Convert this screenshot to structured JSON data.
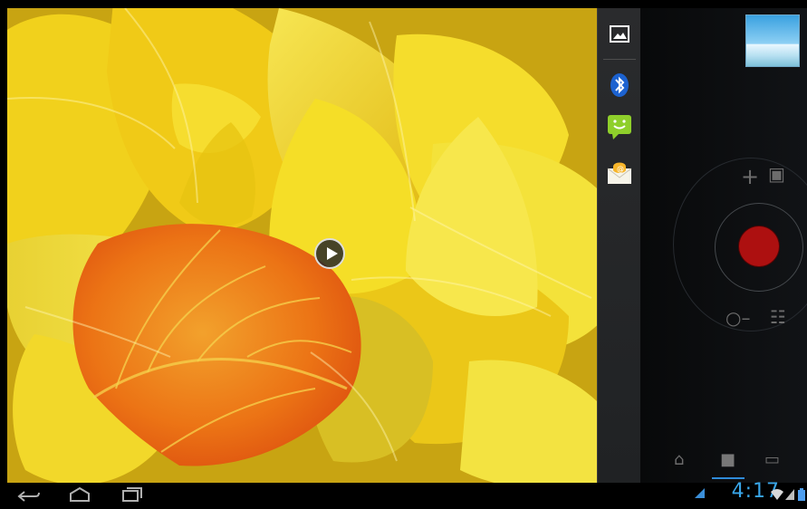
{
  "preview": {
    "play_label": "play"
  },
  "share_panel": {
    "items": [
      {
        "name": "gallery",
        "icon": "image-icon"
      },
      {
        "name": "bluetooth",
        "icon": "bluetooth-icon"
      },
      {
        "name": "messaging",
        "icon": "smiley-message-icon"
      },
      {
        "name": "email",
        "icon": "envelope-icon"
      }
    ]
  },
  "camera": {
    "controls": [
      "zoom-plus",
      "switch-camera",
      "zoom-minus",
      "settings"
    ],
    "modes": [
      "camera-icon",
      "video-icon",
      "panorama-icon"
    ],
    "selected_mode": "video"
  },
  "status_bar": {
    "time": "4:17",
    "icons": [
      "notification-icon",
      "wifi-icon",
      "signal-icon",
      "battery-icon"
    ]
  },
  "nav": {
    "buttons": [
      "back-icon",
      "home-icon",
      "recent-apps-icon"
    ]
  },
  "colors": {
    "accent": "#39a6e9",
    "record": "#ad1010",
    "leaf": "#f2cf1b",
    "orange_leaf": "#ed7315"
  }
}
